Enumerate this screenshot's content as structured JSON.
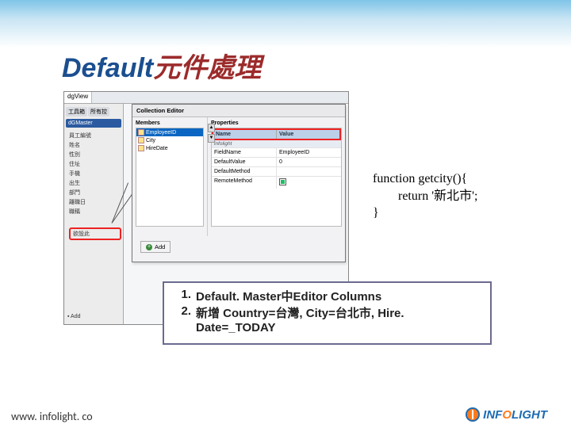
{
  "title": {
    "blue": "Default",
    "red": "元件處理"
  },
  "ide": {
    "tab": "dgView",
    "side": {
      "tabs": [
        "工具箱",
        "所有控"
      ],
      "chip": "dGMaster",
      "items": [
        "員工編號",
        "姓名",
        "性別",
        "住址",
        "手機",
        "出生",
        "部門",
        "離職日",
        "職稱"
      ],
      "highlight": "欲設此"
    },
    "add_btn": "Add"
  },
  "dialog": {
    "title": "Collection Editor",
    "members_label": "Members",
    "members": [
      "EmployeeID",
      "City",
      "HireDate"
    ],
    "props_label": "Properties",
    "head_name": "Name",
    "head_value": "Value",
    "category": "infolight",
    "rows": [
      {
        "n": "FieldName",
        "v": "EmployeeID"
      },
      {
        "n": "DefaultValue",
        "v": "0"
      },
      {
        "n": "DefaultMethod",
        "v": ""
      },
      {
        "n": "RemoteMethod",
        "v": "",
        "chk": true
      }
    ],
    "add": "Add"
  },
  "code": {
    "l1": "function getcity(){",
    "l2": "return '新北市';",
    "l3": "}"
  },
  "instructions": [
    {
      "num": "1.",
      "txt": "Default. Master中Editor Columns"
    },
    {
      "num": "2.",
      "txt": "新增 Country=台灣, City=台北市, Hire. Date=_TODAY"
    }
  ],
  "footer": "www. infolight. co",
  "logo": {
    "brand_a": "INF",
    "brand_b": "LIGHT"
  }
}
